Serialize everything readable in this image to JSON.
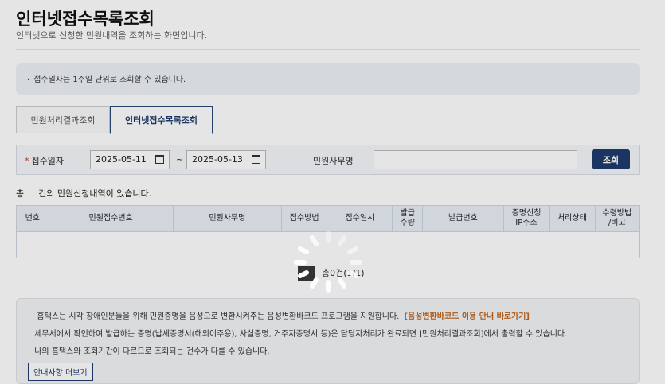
{
  "header": {
    "title": "인터넷접수목록조회",
    "subtitle": "인터넷으로 신청한 민원내역을 조회하는 화면입니다."
  },
  "notice": "접수일자는 1주일 단위로 조회할 수 있습니다.",
  "tabs": [
    {
      "label": "민원처리결과조회"
    },
    {
      "label": "인터넷접수목록조회"
    }
  ],
  "search": {
    "date_label": "접수일자",
    "date_from": "2025-05-11",
    "date_to": "2025-05-13",
    "tilde": "~",
    "office_label": "민원사무명",
    "office_value": "",
    "search_button": "조회"
  },
  "result": {
    "prefix": "총",
    "suffix": "건의 민원신청내역이 있습니다."
  },
  "table": {
    "headers": [
      "번호",
      "민원접수번호",
      "민원사무명",
      "접수방법",
      "접수일시",
      "발급\n수량",
      "발급번호",
      "증명신청\nIP주소",
      "처리상태",
      "수령방법\n/비고"
    ]
  },
  "paging": "총0건(1/1)",
  "info": {
    "line1": "홈택스는 시각 장애인분들을 위해 민원증명을 음성으로 변환시켜주는 음성변환바코드 프로그램을 지원합니다.",
    "line1_link": "[음성변환바코드 이용 안내 바로가기]",
    "line2": "세무서에서 확인하여 발급하는 증명(납세증명서(해외이주용), 사실증명, 거주자증명서 등)은 담당자처리가 완료되면 [민원처리결과조회]에서 출력할 수 있습니다.",
    "line3": "나의 홈택스와 조회기간이 다르므로 조회되는 건수가 다를 수 있습니다.",
    "more_button": "안내사항 더보기"
  },
  "colors": {
    "primary": "#1f3b6d",
    "link": "#c0651c",
    "required": "#d32f2f"
  },
  "icons": {
    "date_picker": "calendar-icon",
    "loading": "spinner-icon"
  }
}
